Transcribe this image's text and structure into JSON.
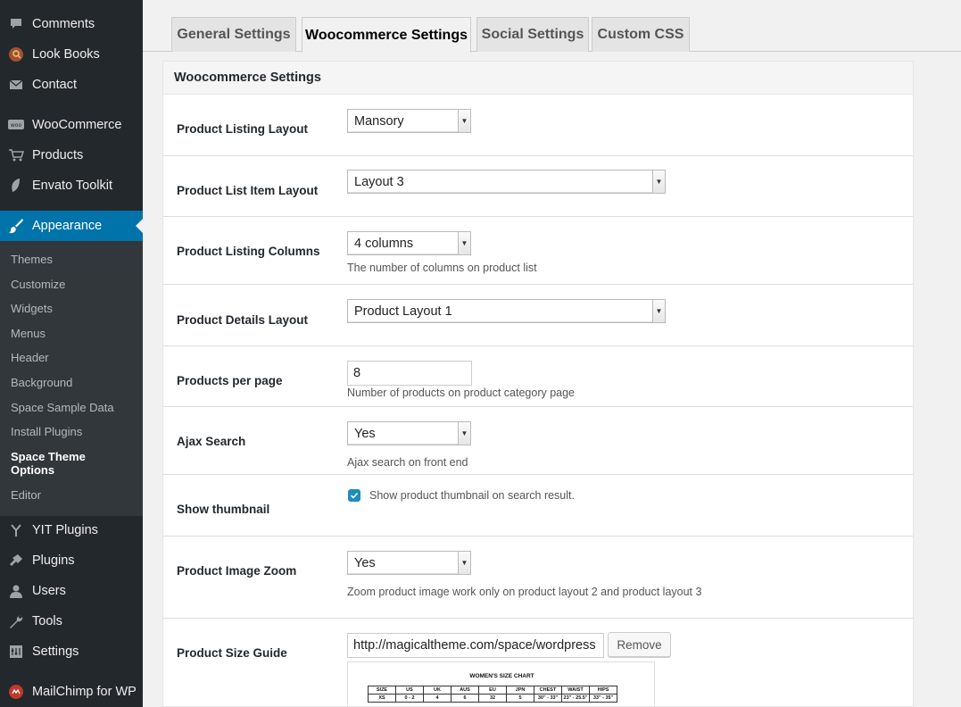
{
  "sidebar": {
    "items": [
      {
        "label": "Comments",
        "icon": "comments-icon"
      },
      {
        "label": "Look Books",
        "icon": "lookbooks-icon"
      },
      {
        "label": "Contact",
        "icon": "mail-icon"
      },
      {
        "label": "WooCommerce",
        "icon": "woocommerce-icon"
      },
      {
        "label": "Products",
        "icon": "cart-icon"
      },
      {
        "label": "Envato Toolkit",
        "icon": "leaf-icon"
      },
      {
        "label": "Appearance",
        "icon": "brush-icon"
      },
      {
        "label": "YIT Plugins",
        "icon": "yit-icon"
      },
      {
        "label": "Plugins",
        "icon": "plugin-icon"
      },
      {
        "label": "Users",
        "icon": "user-icon"
      },
      {
        "label": "Tools",
        "icon": "wrench-icon"
      },
      {
        "label": "Settings",
        "icon": "settings-icon"
      },
      {
        "label": "MailChimp for WP",
        "icon": "mailchimp-icon"
      }
    ],
    "submenu": [
      "Themes",
      "Customize",
      "Widgets",
      "Menus",
      "Header",
      "Background",
      "Space Sample Data",
      "Install Plugins",
      "Space Theme Options",
      "Editor"
    ]
  },
  "tabs": [
    "General Settings",
    "Woocommerce Settings",
    "Social Settings",
    "Custom CSS"
  ],
  "panel": {
    "title": "Woocommerce Settings",
    "rows": {
      "listing_layout": {
        "label": "Product Listing Layout",
        "value": "Mansory"
      },
      "list_item_layout": {
        "label": "Product List Item Layout",
        "value": "Layout 3"
      },
      "listing_columns": {
        "label": "Product Listing Columns",
        "value": "4 columns",
        "desc": "The number of columns on product list"
      },
      "details_layout": {
        "label": "Product Details Layout",
        "value": "Product Layout 1"
      },
      "per_page": {
        "label": "Products per page",
        "value": "8",
        "desc": "Number of products on product category page"
      },
      "ajax_search": {
        "label": "Ajax Search",
        "value": "Yes",
        "desc": "Ajax search on front end"
      },
      "show_thumbnail": {
        "label": "Show thumbnail",
        "checkbox_label": "Show product thumbnail on search result.",
        "checked": true
      },
      "image_zoom": {
        "label": "Product Image Zoom",
        "value": "Yes",
        "desc": "Zoom product image work only on product layout 2 and product layout 3"
      },
      "size_guide": {
        "label": "Product Size Guide",
        "url": "http://magicaltheme.com/space/wordpress",
        "remove_label": "Remove"
      }
    },
    "size_chart": {
      "title": "WOMEN'S SIZE CHART",
      "headers": [
        "SIZE",
        "US",
        "UK",
        "AUS",
        "EU",
        "JPN",
        "CHEST",
        "WAIST",
        "HIPS"
      ],
      "row": [
        "XS",
        "0 - 2",
        "4",
        "6",
        "32",
        "5",
        "30\" - 33\"",
        "23\" - 25.5\"",
        "33\" - 35\""
      ]
    }
  },
  "colors": {
    "sidebar_bg": "#23282d",
    "submenu_bg": "#32373c",
    "active": "#0073aa"
  }
}
